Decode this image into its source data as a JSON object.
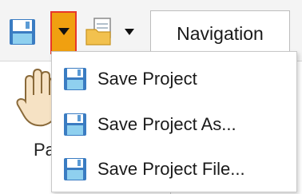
{
  "toolbar": {
    "tabs": [
      {
        "label": "Navigation"
      }
    ],
    "left_panel_label_partial": "Pa"
  },
  "menu": {
    "items": [
      {
        "label": "Save Project",
        "icon": "floppy-disk-icon"
      },
      {
        "label": "Save Project As...",
        "icon": "floppy-disk-icon"
      },
      {
        "label": "Save Project File...",
        "icon": "floppy-disk-icon"
      }
    ]
  },
  "colors": {
    "floppy_body": "#5b9bd5",
    "floppy_label": "#8fd0ef",
    "accent_highlight": "#f0a010",
    "highlight_border": "#e8362a",
    "folder": "#f2c14e"
  }
}
